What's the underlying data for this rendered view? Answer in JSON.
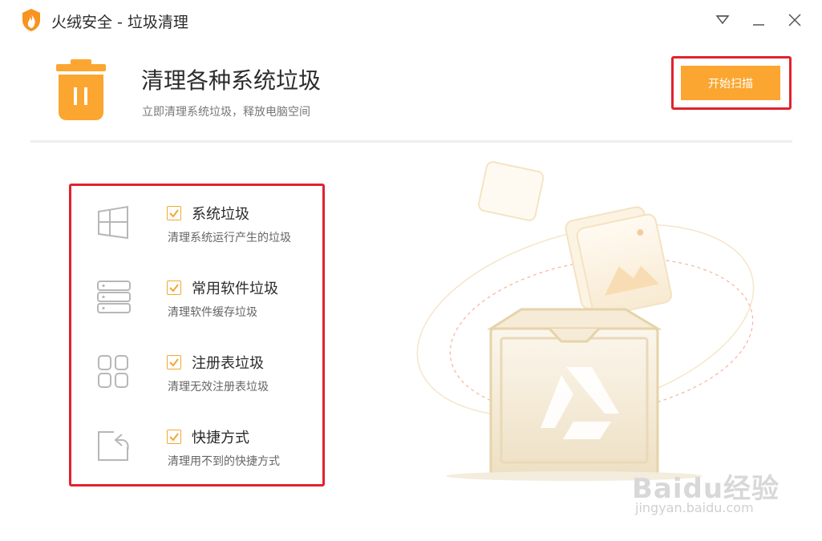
{
  "window": {
    "title": "火绒安全 - 垃圾清理",
    "icons": [
      "huorong-logo-icon",
      "menu-dropdown-icon",
      "minimize-icon",
      "close-icon"
    ]
  },
  "header": {
    "title": "清理各种系统垃圾",
    "subtitle": "立即清理系统垃圾，释放电脑空间",
    "scan_button": "开始扫描"
  },
  "items": [
    {
      "icon": "windows-icon",
      "label": "系统垃圾",
      "desc": "清理系统运行产生的垃圾",
      "checked": true
    },
    {
      "icon": "server-stack-icon",
      "label": "常用软件垃圾",
      "desc": "清理软件缓存垃圾",
      "checked": true
    },
    {
      "icon": "grid-blocks-icon",
      "label": "注册表垃圾",
      "desc": "清理无效注册表垃圾",
      "checked": true
    },
    {
      "icon": "shortcut-arrow-icon",
      "label": "快捷方式",
      "desc": "清理用不到的快捷方式",
      "checked": true
    }
  ],
  "watermark": {
    "main": "Baidu经验",
    "sub": "jingyan.baidu.com"
  },
  "colors": {
    "accent": "#fba631",
    "highlight_frame": "#e0232e",
    "checkbox": "#f4a733"
  }
}
